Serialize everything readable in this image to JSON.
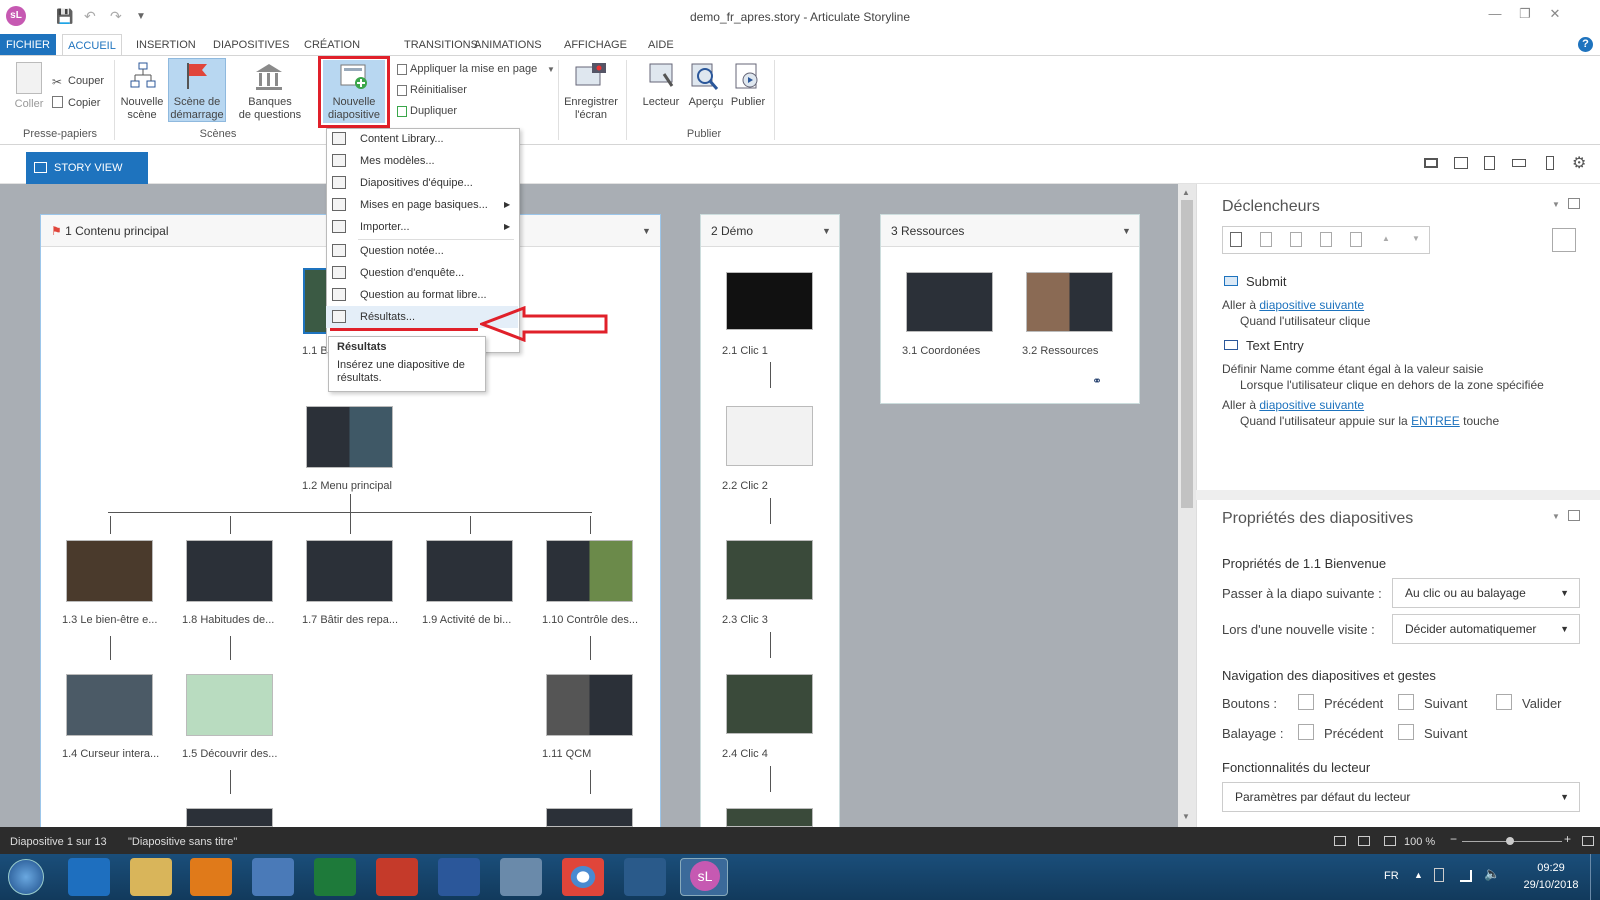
{
  "window": {
    "title": "demo_fr_apres.story - Articulate Storyline",
    "logo": "sL"
  },
  "menu_tabs": [
    "FICHIER",
    "ACCUEIL",
    "INSERTION",
    "DIAPOSITIVES",
    "CRÉATION",
    "TRANSITIONS",
    "ANIMATIONS",
    "AFFICHAGE",
    "AIDE"
  ],
  "ribbon": {
    "coller": "Coller",
    "couper": "Couper",
    "copier": "Copier",
    "presse_papiers": "Presse-papiers",
    "nouvelle_scene": [
      "Nouvelle",
      "scène"
    ],
    "scene_demarrage": [
      "Scène de",
      "démarrage"
    ],
    "banques": [
      "Banques",
      "de questions"
    ],
    "scenes": "Scènes",
    "nouvelle_diapositive": [
      "Nouvelle",
      "diapositive"
    ],
    "appliquer": "Appliquer la mise en page",
    "reinitialiser": "Réinitialiser",
    "dupliquer": "Dupliquer",
    "enregistrer": [
      "Enregistrer",
      "l'écran"
    ],
    "lecteur": "Lecteur",
    "apercu": "Aperçu",
    "publier": "Publier",
    "publier_group": "Publier"
  },
  "story_view_tab": "STORY VIEW",
  "dropdown_menu": [
    {
      "label": "Content Library...",
      "arrow": false
    },
    {
      "label": "Mes modèles...",
      "arrow": false
    },
    {
      "label": "Diapositives d'équipe...",
      "arrow": false
    },
    {
      "label": "Mises en page basiques...",
      "arrow": true
    },
    {
      "label": "Importer...",
      "arrow": true
    },
    {
      "label": "Question notée...",
      "arrow": false
    },
    {
      "label": "Question d'enquête...",
      "arrow": false
    },
    {
      "label": "Question au format libre...",
      "arrow": false
    },
    {
      "label": "Résultats...",
      "arrow": false
    }
  ],
  "tooltip": {
    "title": "Résultats",
    "body": "Insérez une diapositive de résultats."
  },
  "scenes": {
    "s1": {
      "title": "1 Contenu principal",
      "slides": {
        "a": "1.1 B",
        "b": "1.2 Menu principal",
        "c": "1.3 Le bien-être e...",
        "d": "1.8 Habitudes de...",
        "e": "1.7 Bâtir des repa...",
        "f": "1.9 Activité de bi...",
        "g": "1.10 Contrôle des...",
        "h": "1.4 Curseur intera...",
        "i": "1.5 Découvrir des...",
        "j": "1.11 QCM"
      }
    },
    "s2": {
      "title": "2 Démo",
      "slides": [
        "2.1 Clic 1",
        "2.2 Clic 2",
        "2.3 Clic 3",
        "2.4 Clic 4"
      ]
    },
    "s3": {
      "title": "3 Ressources",
      "slides": [
        "3.1 Coordonées",
        "3.2 Ressources"
      ]
    }
  },
  "triggers": {
    "header": "Déclencheurs",
    "submit": "Submit",
    "aller_a": "Aller à",
    "diapositive_suivante": "diapositive suivante",
    "quand_clique": "Quand l'utilisateur clique",
    "text_entry": "Text Entry",
    "definir": "Définir Name comme étant égal à la valeur saisie",
    "lorsque": "Lorsque l'utilisateur clique en dehors de la zone spécifiée",
    "quand_appuie": "Quand l'utilisateur appuie sur la",
    "entree": "ENTREE",
    "touche": "touche"
  },
  "props": {
    "header": "Propriétés des diapositives",
    "sub": "Propriétés de 1.1 Bienvenue",
    "passer_label": "Passer à la diapo suivante :",
    "passer_value": "Au clic ou au balayage",
    "visite_label": "Lors d'une nouvelle visite :",
    "visite_value": "Décider automatiquemer",
    "nav_header": "Navigation des diapositives et gestes",
    "boutons": "Boutons :",
    "balayage": "Balayage :",
    "precedent": "Précédent",
    "suivant": "Suivant",
    "valider": "Valider",
    "fonc_header": "Fonctionnalités du lecteur",
    "lecteur_value": "Paramètres par défaut du lecteur"
  },
  "status": {
    "slide": "Diapositive 1 sur 13",
    "name": "\"Diapositive sans titre\"",
    "zoom": "100 %"
  },
  "taskbar": {
    "lang": "FR",
    "time": "09:29",
    "date": "29/10/2018"
  },
  "colors": {
    "accent": "#1e73be",
    "highlight": "#e0202a",
    "logo": "#c659b2"
  }
}
